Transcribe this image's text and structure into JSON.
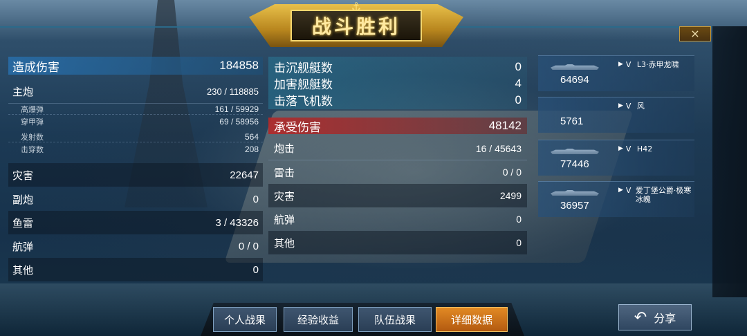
{
  "title": "战斗胜利",
  "close_icon": "×",
  "dealt": {
    "header_label": "造成伤害",
    "header_value": "184858",
    "rows": [
      {
        "label": "主炮",
        "value": "230 / 118885",
        "kind": "major"
      },
      {
        "label": "高爆弹",
        "value": "161 / 59929",
        "kind": "sub"
      },
      {
        "label": "穿甲弹",
        "value": "69 / 58956",
        "kind": "sub"
      },
      {
        "label": "发射数",
        "value": "564",
        "kind": "sub"
      },
      {
        "label": "击穿数",
        "value": "208",
        "kind": "sub"
      },
      {
        "label": "灾害",
        "value": "22647",
        "kind": "major"
      },
      {
        "label": "副炮",
        "value": "0",
        "kind": "major"
      },
      {
        "label": "鱼雷",
        "value": "3 / 43326",
        "kind": "major"
      },
      {
        "label": "航弹",
        "value": "0 / 0",
        "kind": "major"
      },
      {
        "label": "其他",
        "value": "0",
        "kind": "major"
      }
    ]
  },
  "kills": [
    {
      "label": "击沉舰艇数",
      "value": "0"
    },
    {
      "label": "加害舰艇数",
      "value": "4"
    },
    {
      "label": "击落飞机数",
      "value": "0"
    }
  ],
  "received": {
    "header_label": "承受伤害",
    "header_value": "48142",
    "rows": [
      {
        "label": "炮击",
        "value": "16 / 45643"
      },
      {
        "label": "雷击",
        "value": "0 / 0"
      },
      {
        "label": "灾害",
        "value": "2499"
      },
      {
        "label": "航弹",
        "value": "0"
      },
      {
        "label": "其他",
        "value": "0"
      }
    ]
  },
  "ships": [
    {
      "tier": "V",
      "name": "L3·赤甲龙啸",
      "damage": "64694"
    },
    {
      "tier": "V",
      "name": "风",
      "damage": "5761"
    },
    {
      "tier": "V",
      "name": "H42",
      "damage": "77446"
    },
    {
      "tier": "V",
      "name": "爱丁堡公爵·极寒冰魄",
      "damage": "36957"
    }
  ],
  "tabs": [
    {
      "label": "个人战果",
      "active": false
    },
    {
      "label": "经验收益",
      "active": false
    },
    {
      "label": "队伍战果",
      "active": false
    },
    {
      "label": "详细数据",
      "active": true
    }
  ],
  "share_label": "分享",
  "colors": {
    "active_tab": "#e28a24",
    "dealt_header": "#2a6ea8",
    "received_header": "#b42828",
    "title_gold": "#e8c04a"
  }
}
